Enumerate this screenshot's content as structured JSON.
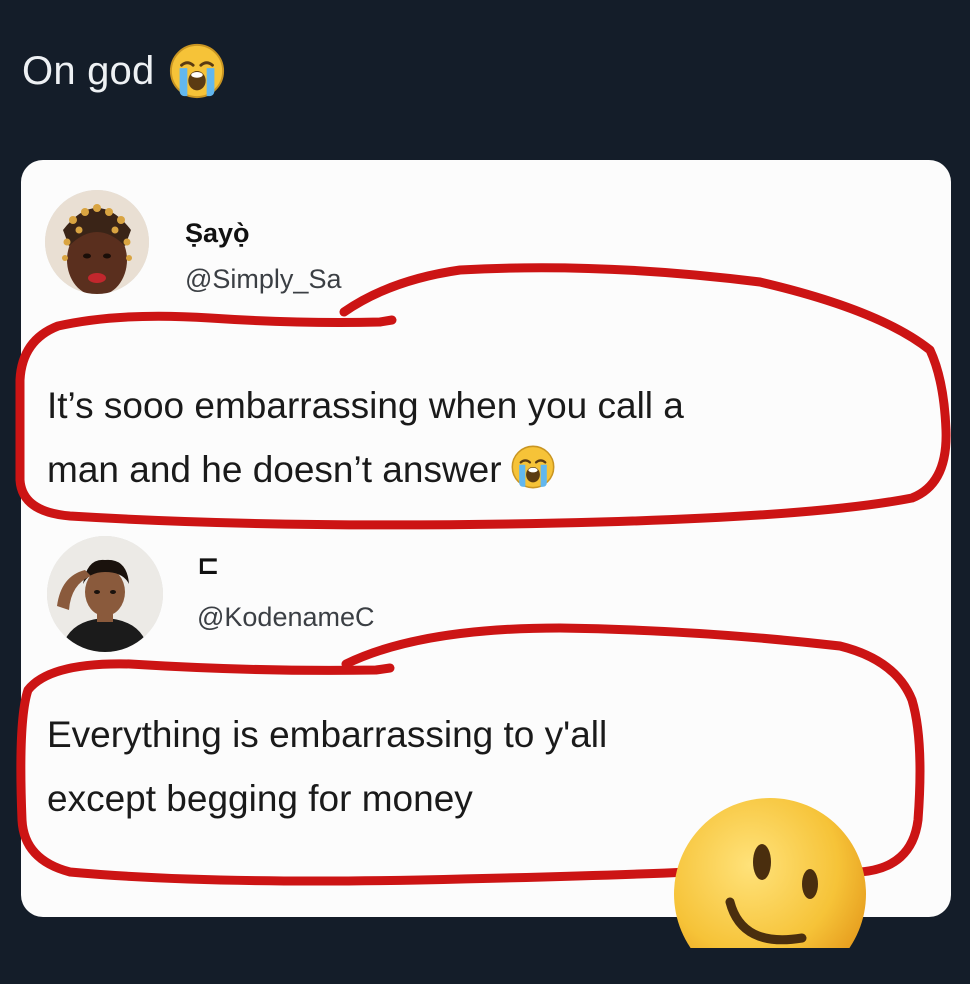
{
  "post": {
    "caption": "On god"
  },
  "tweets": [
    {
      "display_name": "Ṣayọ̀",
      "handle": "@Simply_Sa",
      "text_line_1": "It’s sooo embarrassing when you call a",
      "text_line_2": "man and he doesn’t answer"
    },
    {
      "display_name": "⊏",
      "handle": "@KodenameC",
      "text_line_1": "Everything is embarrassing to y'all",
      "text_line_2": "except begging for money"
    }
  ],
  "colors": {
    "background": "#141d29",
    "card": "#fcfcfc",
    "annotation_red": "#cc1414",
    "emoji_yellow": "#f6c338"
  },
  "icons": {
    "caption_emoji": "loudly-crying-face-icon",
    "tweet_1_emoji": "loudly-crying-face-icon",
    "overlay_emoji": "winking-face-icon"
  }
}
